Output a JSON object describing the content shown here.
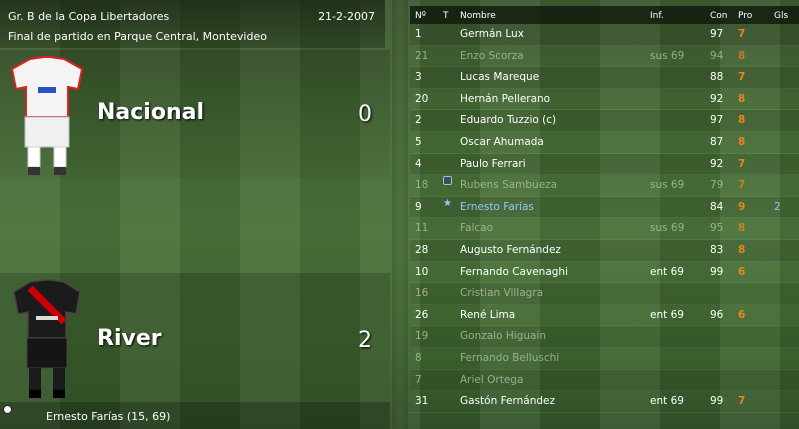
{
  "match": {
    "competition": "Gr. B de la Copa Libertadores",
    "date": "21-2-2007",
    "venue_line": "Final de partido en Parque Central, Montevideo"
  },
  "home": {
    "name": "Nacional",
    "score": "0"
  },
  "away": {
    "name": "River",
    "score": "2"
  },
  "scorers_line": "Ernesto Farías (15, 69)",
  "table": {
    "headers": {
      "num": "Nº",
      "t": "T",
      "name": "Nombre",
      "inf": "Inf.",
      "con": "Con",
      "pro": "Pro",
      "gls": "Gls"
    },
    "rows": [
      {
        "num": "1",
        "name": "Germán Lux",
        "inf": "",
        "con": "97",
        "pro": "7",
        "gls": ""
      },
      {
        "num": "21",
        "name": "Enzo Scorza",
        "inf": "sus 69",
        "con": "94",
        "pro": "8",
        "gls": ""
      },
      {
        "num": "3",
        "name": "Lucas Mareque",
        "inf": "",
        "con": "88",
        "pro": "7",
        "gls": ""
      },
      {
        "num": "20",
        "name": "Hernán Pellerano",
        "inf": "",
        "con": "92",
        "pro": "8",
        "gls": ""
      },
      {
        "num": "2",
        "name": "Eduardo Tuzzio (c)",
        "inf": "",
        "con": "97",
        "pro": "8",
        "gls": ""
      },
      {
        "num": "5",
        "name": "Oscar Ahumada",
        "inf": "",
        "con": "87",
        "pro": "8",
        "gls": ""
      },
      {
        "num": "4",
        "name": "Paulo Ferrari",
        "inf": "",
        "con": "92",
        "pro": "7",
        "gls": ""
      },
      {
        "num": "18",
        "name": "Rubens Sambueza",
        "inf": "sus 69",
        "con": "79",
        "pro": "7",
        "gls": ""
      },
      {
        "num": "9",
        "name": "Ernesto Farías",
        "inf": "",
        "con": "84",
        "pro": "9",
        "gls": "2"
      },
      {
        "num": "11",
        "name": "Falcao",
        "inf": "sus 69",
        "con": "95",
        "pro": "8",
        "gls": ""
      },
      {
        "num": "28",
        "name": "Augusto Fernández",
        "inf": "",
        "con": "83",
        "pro": "8",
        "gls": ""
      },
      {
        "num": "10",
        "name": "Fernando Cavenaghi",
        "inf": "ent 69",
        "con": "99",
        "pro": "6",
        "gls": ""
      },
      {
        "num": "16",
        "name": "Cristian Villagra",
        "inf": "",
        "con": "",
        "pro": "",
        "gls": ""
      },
      {
        "num": "26",
        "name": "René Lima",
        "inf": "ent 69",
        "con": "96",
        "pro": "6",
        "gls": ""
      },
      {
        "num": "19",
        "name": "Gonzalo Higuaín",
        "inf": "",
        "con": "",
        "pro": "",
        "gls": ""
      },
      {
        "num": "8",
        "name": "Fernando Belluschi",
        "inf": "",
        "con": "",
        "pro": "",
        "gls": ""
      },
      {
        "num": "7",
        "name": "Ariel Ortega",
        "inf": "",
        "con": "",
        "pro": "",
        "gls": ""
      },
      {
        "num": "31",
        "name": "Gastón Fernández",
        "inf": "ent 69",
        "con": "99",
        "pro": "7",
        "gls": ""
      }
    ]
  },
  "colors": {
    "rating": "#e8861e",
    "highlight": "#8fc8ff",
    "dim_text": "#b9c4b0"
  },
  "icons": {
    "row8": "substitution-icon",
    "row9": "star-icon",
    "scorers": "ball-icon"
  }
}
